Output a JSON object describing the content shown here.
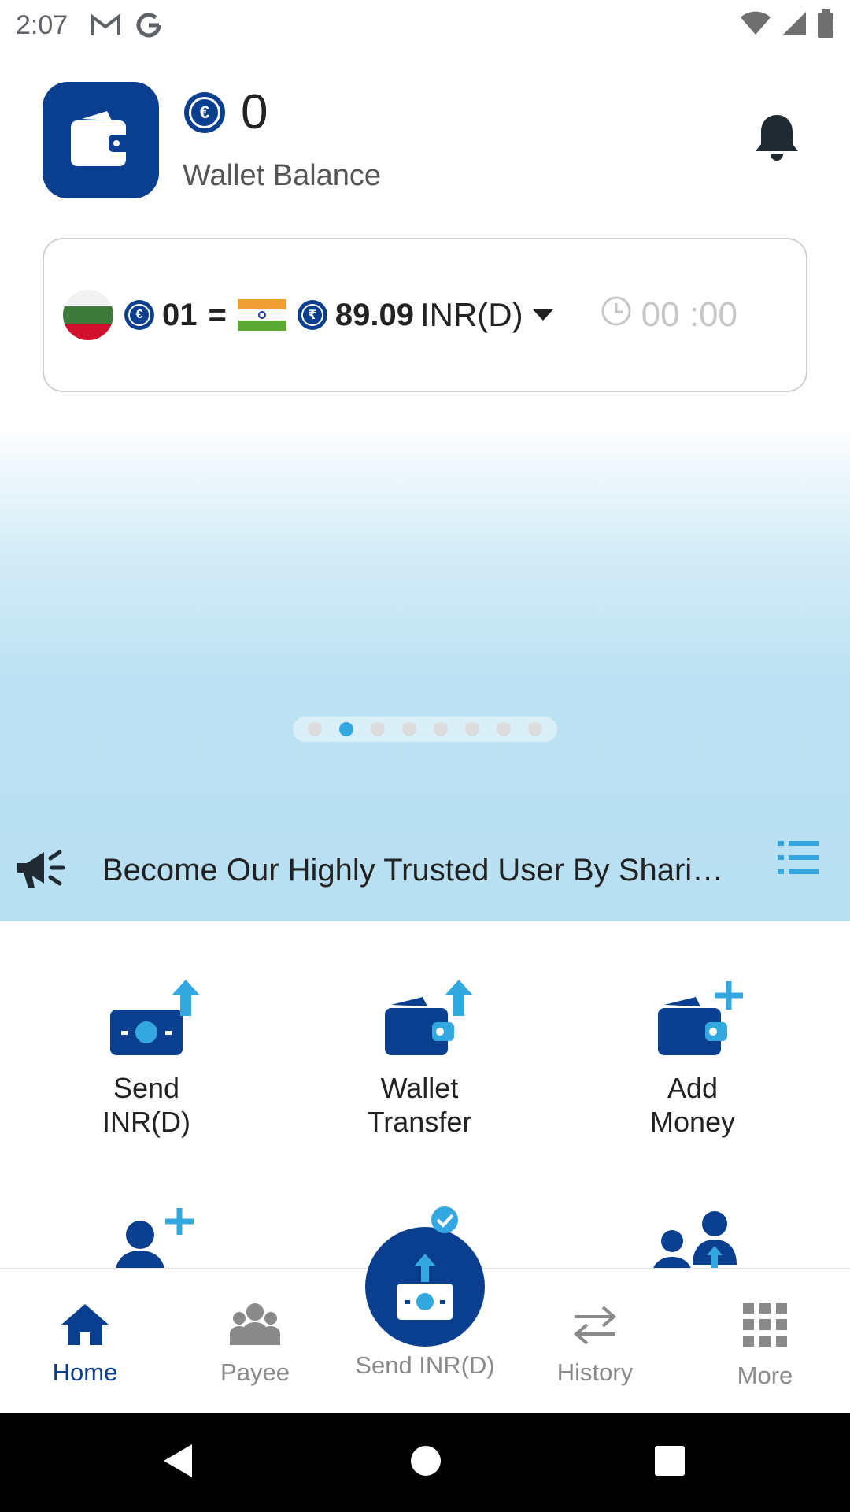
{
  "status_bar": {
    "time": "2:07",
    "icons": [
      "gmail-icon",
      "google-icon",
      "wifi-icon",
      "signal-icon",
      "battery-icon"
    ]
  },
  "header": {
    "balance": "0",
    "balance_label": "Wallet Balance",
    "coin_symbol": "€",
    "notification_icon": "bell-icon"
  },
  "rate_card": {
    "from_amount": "01",
    "equals": "=",
    "to_amount": "89.09",
    "currency": "INR(D)",
    "coin_symbol_from": "€",
    "coin_symbol_to": "₹",
    "timer": "00 :00"
  },
  "banner": {
    "slides": 8,
    "active_slide": 2
  },
  "announcement": {
    "text": "Become Our Highly Trusted User By Sharin..."
  },
  "actions": [
    {
      "line1": "Send",
      "line2": "INR(D)"
    },
    {
      "line1": "Wallet",
      "line2": "Transfer"
    },
    {
      "line1": "Add",
      "line2": "Money"
    }
  ],
  "bottom_nav": {
    "home": "Home",
    "payee": "Payee",
    "send": "Send INR(D)",
    "history": "History",
    "more": "More"
  },
  "colors": {
    "brand_navy": "#0a3f8f",
    "accent_blue": "#33a8e0",
    "banner_blue": "#b8e0f2"
  }
}
